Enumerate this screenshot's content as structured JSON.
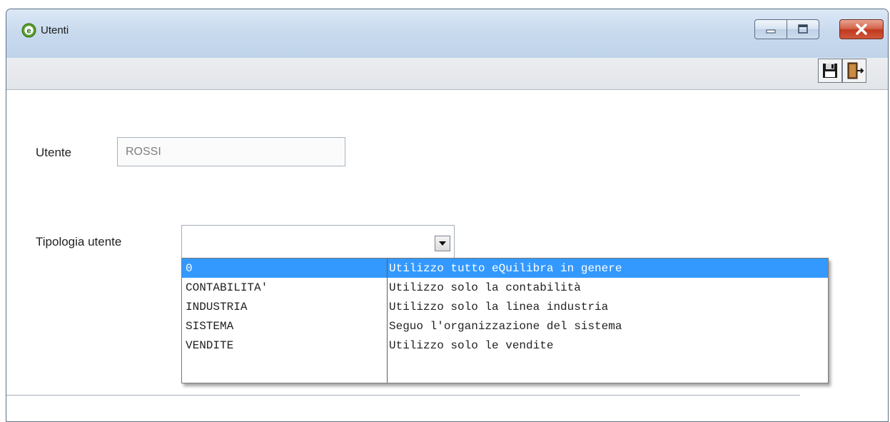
{
  "window": {
    "title": "Utenti",
    "icon": "equilibra-app-icon",
    "controls": [
      "minimize-icon",
      "maximize-icon",
      "close-icon"
    ]
  },
  "toolbar": {
    "buttons": [
      "save-icon",
      "exit-door-icon"
    ]
  },
  "form": {
    "user_label": "Utente",
    "user_value": "ROSSI",
    "type_label": "Tipologia utente",
    "type_value": ""
  },
  "dropdown": {
    "selected_index": 0,
    "options": [
      {
        "code": "0",
        "description": "Utilizzo tutto eQuilibra in genere"
      },
      {
        "code": "CONTABILITA'",
        "description": "Utilizzo solo la contabilità"
      },
      {
        "code": "INDUSTRIA",
        "description": "Utilizzo solo la linea industria"
      },
      {
        "code": "SISTEMA",
        "description": "Seguo l'organizzazione del sistema"
      },
      {
        "code": "VENDITE",
        "description": "Utilizzo solo le vendite"
      }
    ]
  },
  "colors": {
    "selection": "#3399ff",
    "titlebar": "#c9daee",
    "close_button": "#c0391f"
  }
}
